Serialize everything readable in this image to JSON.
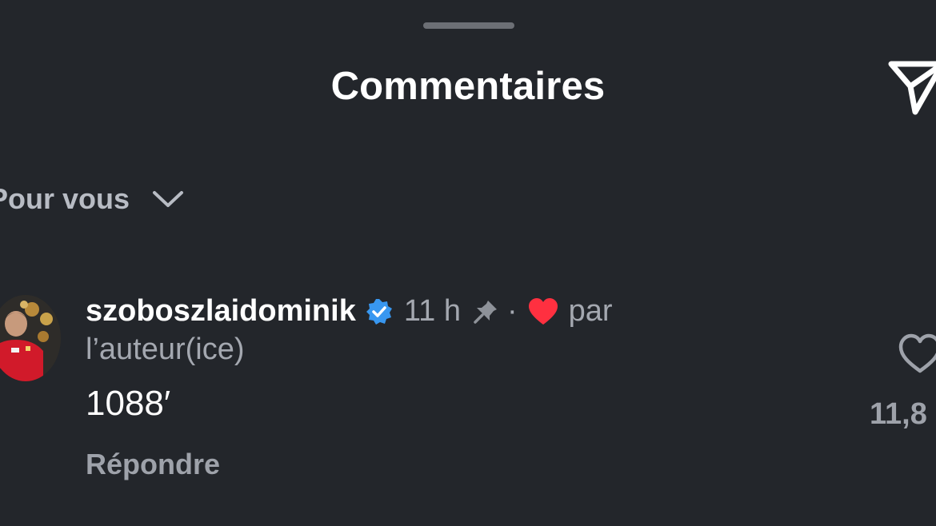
{
  "header": {
    "title": "Commentaires"
  },
  "filter": {
    "label": "Pour vous"
  },
  "comment": {
    "username": "szoboszlaidominik",
    "verified": true,
    "time": "11 h",
    "separator": "·",
    "by_author_part1": "par",
    "by_author_part2": "l’auteur(ice)",
    "text": "1088′",
    "reply_label": "Répondre",
    "like_count": "11,8"
  },
  "icons": {
    "share": "paper-plane-icon",
    "filter_chevron": "chevron-down-icon",
    "verified": "verified-badge-icon",
    "pinned": "pin-icon",
    "liked_by_author": "heart-filled-icon",
    "like": "heart-outline-icon"
  },
  "colors": {
    "background": "#23262b",
    "primary_text": "#ffffff",
    "secondary_text": "#a4a8b0",
    "verified_blue": "#3897f0",
    "heart_red": "#ff3040"
  }
}
